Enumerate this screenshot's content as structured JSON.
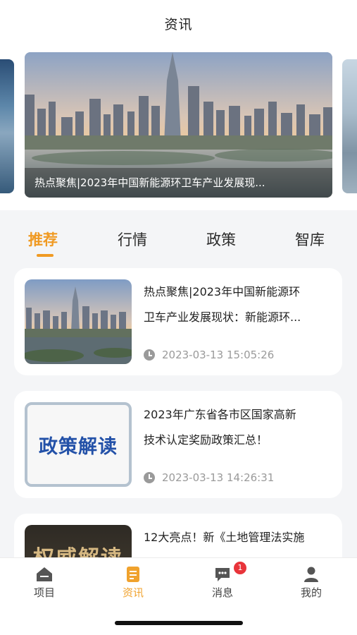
{
  "header": {
    "title": "资讯"
  },
  "banner": {
    "caption": "热点聚焦|2023年中国新能源环卫车产业发展现..."
  },
  "tabs": [
    {
      "label": "推荐",
      "active": true
    },
    {
      "label": "行情",
      "active": false
    },
    {
      "label": "政策",
      "active": false
    },
    {
      "label": "智库",
      "active": false
    }
  ],
  "news": [
    {
      "title_line1": "热点聚焦|2023年中国新能源环",
      "title_line2": "卫车产业发展现状：新能源环...",
      "time": "2023-03-13 15:05:26",
      "thumb": "city-skyline"
    },
    {
      "title_line1": "2023年广东省各市区国家高新",
      "title_line2": "技术认定奖励政策汇总！",
      "time": "2023-03-13 14:26:31",
      "thumb_text": "政策解读"
    },
    {
      "title_line1": "12大亮点！新《土地管理法实施",
      "thumb_text": "权威解读"
    }
  ],
  "tabbar": [
    {
      "label": "项目",
      "icon": "home-icon",
      "active": false
    },
    {
      "label": "资讯",
      "icon": "document-icon",
      "active": true
    },
    {
      "label": "消息",
      "icon": "message-icon",
      "active": false,
      "badge": "1"
    },
    {
      "label": "我的",
      "icon": "user-icon",
      "active": false
    }
  ],
  "colors": {
    "accent": "#f09a23",
    "badge": "#e8343a",
    "background": "#f4f5f7"
  }
}
